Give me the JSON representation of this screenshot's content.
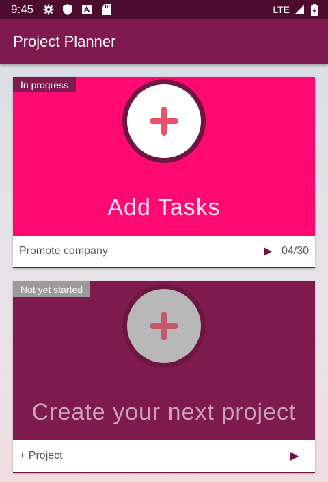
{
  "status_bar": {
    "time": "9:45",
    "icons": [
      "gear-icon",
      "shield-icon",
      "a-badge-icon",
      "sd-card-icon"
    ],
    "network": "LTE",
    "right_icons": [
      "signal-icon",
      "battery-charging-icon"
    ]
  },
  "app_bar": {
    "title": "Project Planner"
  },
  "cards": [
    {
      "status": "In progress",
      "caption": "Add Tasks",
      "footer_label": "Promote company",
      "footer_count": "04/30",
      "media_color": "#ff0a73",
      "icon": "plus-icon"
    },
    {
      "status": "Not yet started",
      "caption": "Create your next project",
      "footer_label": "+ Project",
      "media_color": "#7e1a4d",
      "icon": "plus-icon"
    }
  ],
  "colors": {
    "primary": "#7e1a4d",
    "primary_dark": "#4d0b2e",
    "accent": "#ff0a73",
    "plus": "#e8536b"
  }
}
